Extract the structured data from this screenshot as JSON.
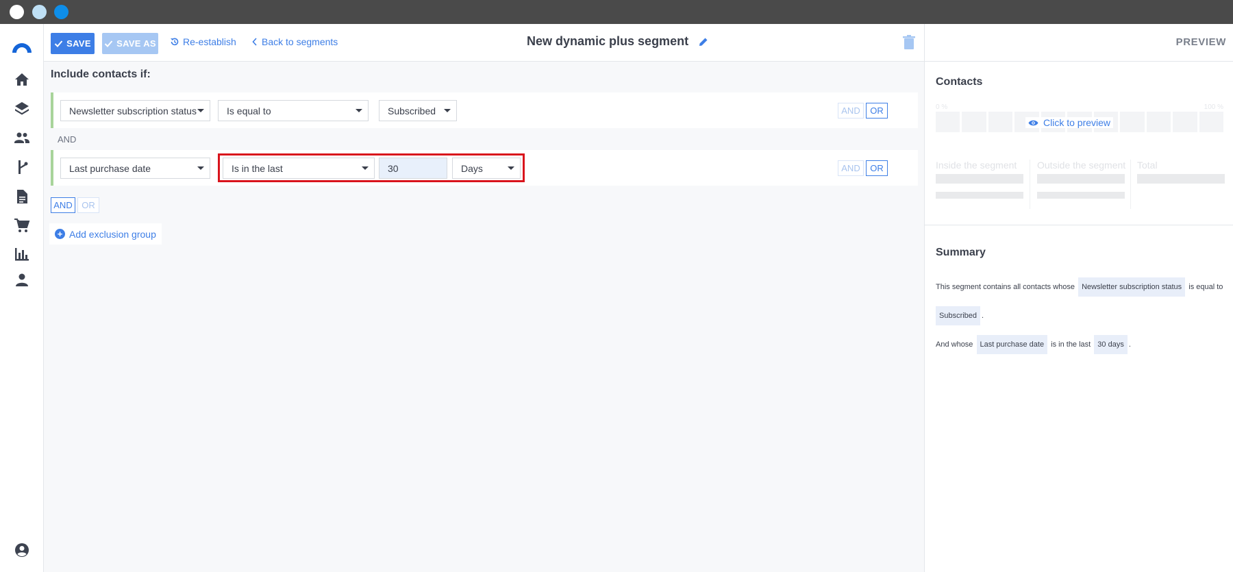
{
  "toolbar": {
    "save_label": "SAVE",
    "save_as_label": "SAVE AS",
    "reestablish_label": "Re-establish",
    "back_label": "Back to segments",
    "title": "New dynamic plus segment"
  },
  "main": {
    "include_title": "Include contacts if:",
    "conditions": [
      {
        "field": "Newsletter subscription status",
        "operator": "Is equal to",
        "value": "Subscribed",
        "and_label": "AND",
        "or_label": "OR"
      },
      {
        "field": "Last purchase date",
        "operator": "Is in the last",
        "number": "30",
        "unit": "Days",
        "and_label": "AND",
        "or_label": "OR"
      }
    ],
    "join_label": "AND",
    "group_and_label": "AND",
    "group_or_label": "OR",
    "add_exclusion_label": "Add exclusion group"
  },
  "preview": {
    "header": "PREVIEW",
    "contacts_title": "Contacts",
    "pct_min": "0 %",
    "pct_max": "100 %",
    "click_to_preview": "Click to preview",
    "inside_label": "Inside the segment",
    "outside_label": "Outside the segment",
    "total_label": "Total",
    "summary_title": "Summary",
    "summary": {
      "s1_prefix": "This segment contains all contacts whose",
      "s1_field": "Newsletter subscription status",
      "s1_mid": "is equal to",
      "s1_value": "Subscribed",
      "s2_prefix": "And whose",
      "s2_field": "Last purchase date",
      "s2_mid": "is in the last",
      "s2_value": "30 days"
    }
  },
  "colors": {
    "accent": "#3d7ee6",
    "accent_disabled": "#a6c7f3",
    "condition_bar": "#a8d49a",
    "highlight": "#d9141c"
  },
  "icons": [
    "logo-icon",
    "home-icon",
    "layers-icon",
    "contacts-icon",
    "workflow-icon",
    "document-icon",
    "cart-icon",
    "chart-icon",
    "person-icon",
    "account-icon",
    "check-icon",
    "history-icon",
    "chevron-left-icon",
    "pencil-icon",
    "trash-icon",
    "eye-icon",
    "plus-circle-icon"
  ]
}
